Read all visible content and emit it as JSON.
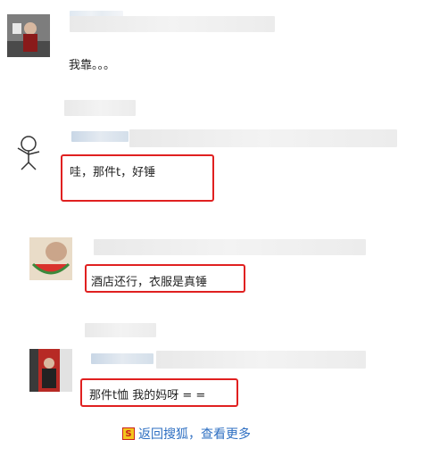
{
  "comments": [
    {
      "avatar": "man-avatar-photo",
      "text": "我靠。。。"
    },
    {
      "avatar": "stick-figure-avatar",
      "text": "哇，那件t，好锤"
    },
    {
      "avatar": "cat-watermelon-avatar",
      "text": "酒店还行，衣服是真锤"
    },
    {
      "avatar": "person-red-door-avatar",
      "text": "那件t恤 我的妈呀 = ="
    }
  ],
  "footer": {
    "back_link": "返回搜狐，查看更多",
    "icon": "sohu-logo-icon"
  },
  "colors": {
    "highlight": "#e02020",
    "link": "#2e6fc2"
  }
}
